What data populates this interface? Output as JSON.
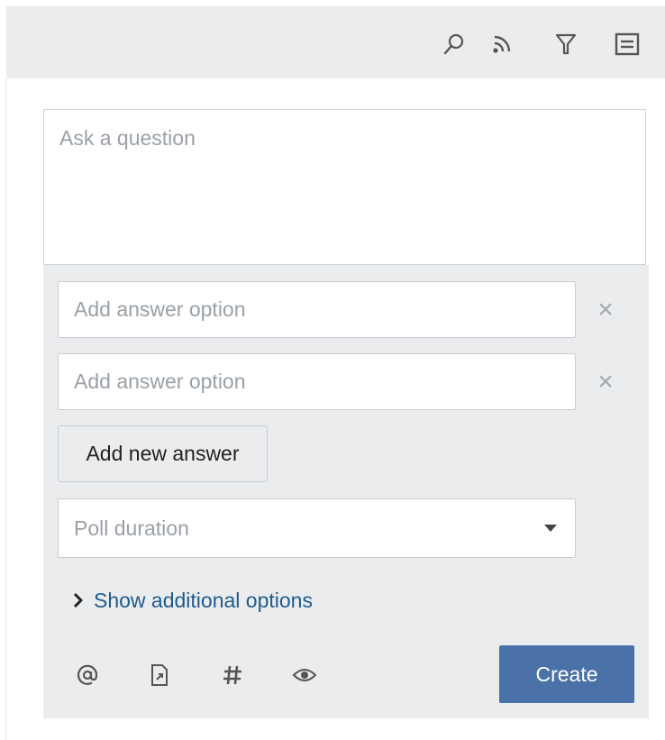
{
  "toolbar": {
    "icons": [
      "search-icon",
      "rss-feed-icon",
      "filter-icon",
      "list-view-icon"
    ]
  },
  "composer": {
    "question_placeholder": "Ask a question",
    "answer_options": [
      {
        "placeholder": "Add answer option",
        "value": ""
      },
      {
        "placeholder": "Add answer option",
        "value": ""
      }
    ],
    "remove_glyph": "×",
    "add_answer_label": "Add new answer",
    "poll_duration_placeholder": "Poll duration",
    "show_options_label": "Show additional options",
    "create_label": "Create",
    "footer_icons": [
      "mention-icon",
      "link-icon",
      "hashtag-icon",
      "visibility-icon"
    ]
  },
  "colors": {
    "toolbar_bg": "#ebecee",
    "panel_bg": "#ebecee",
    "primary": "#4a72a8",
    "link": "#1f5b8f",
    "placeholder": "#9aa0a6"
  }
}
